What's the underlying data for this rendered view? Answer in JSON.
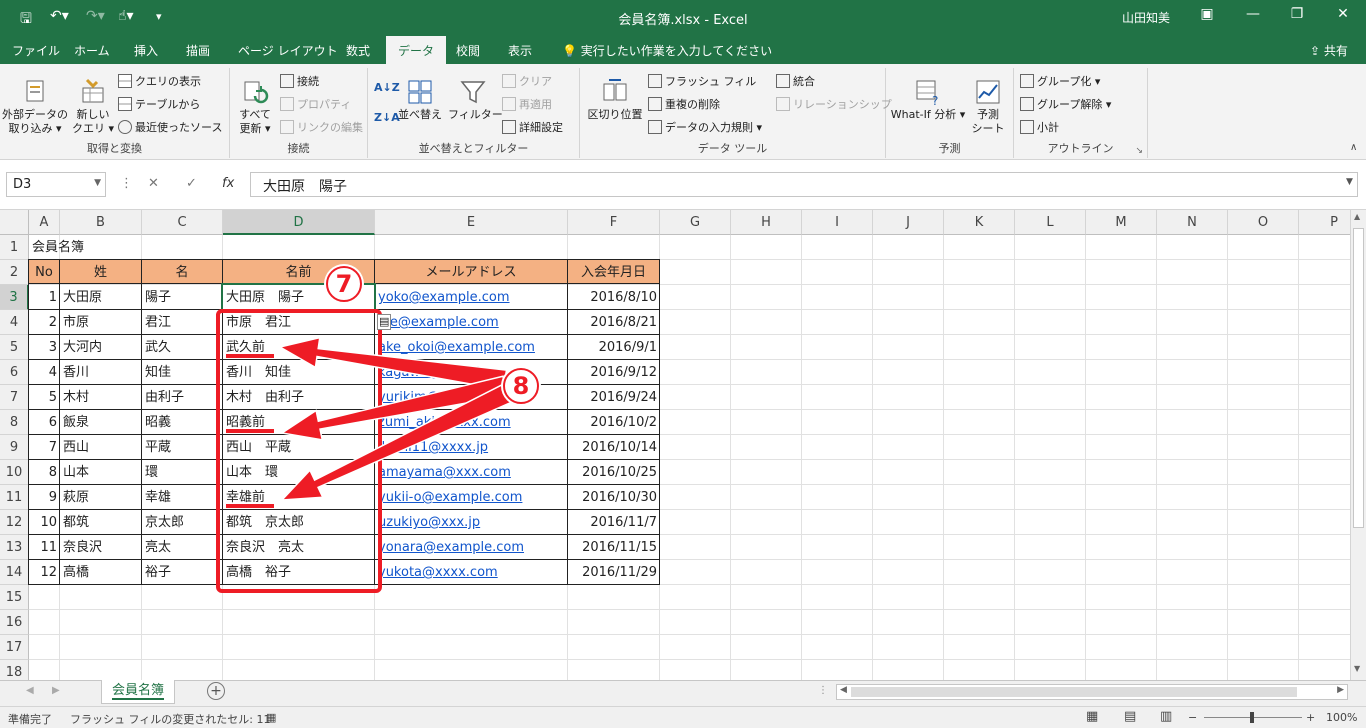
{
  "window": {
    "doc_title": "会員名簿.xlsx  -  Excel",
    "user": "山田知美"
  },
  "tabs": [
    "ファイル",
    "ホーム",
    "挿入",
    "描画",
    "ページ レイアウト",
    "数式",
    "データ",
    "校閲",
    "表示"
  ],
  "active_tab": "データ",
  "tell_me": "実行したい作業を入力してください",
  "share": "共有",
  "ribbon": {
    "get_transform": {
      "label": "取得と変換",
      "external_data": "外部データの",
      "external_data2": "取り込み",
      "new_query": "新しい",
      "new_query2": "クエリ",
      "show_queries": "クエリの表示",
      "from_table": "テーブルから",
      "recent_sources": "最近使ったソース"
    },
    "connections": {
      "label": "接続",
      "refresh_all": "すべて",
      "refresh_all2": "更新",
      "connections": "接続",
      "properties": "プロパティ",
      "edit_links": "リンクの編集"
    },
    "sort_filter": {
      "label": "並べ替えとフィルター",
      "sort": "並べ替え",
      "filter": "フィルター",
      "clear": "クリア",
      "reapply": "再適用",
      "advanced": "詳細設定"
    },
    "data_tools": {
      "label": "データ ツール",
      "text_to_columns": "区切り位置",
      "flash_fill": "フラッシュ フィル",
      "remove_duplicates": "重複の削除",
      "validation": "データの入力規則",
      "consolidate": "統合",
      "relationships": "リレーションシップ"
    },
    "forecast": {
      "label": "予測",
      "what_if": "What-If 分析",
      "forecast_sheet": "予測",
      "forecast_sheet2": "シート"
    },
    "outline": {
      "label": "アウトライン",
      "group": "グループ化",
      "ungroup": "グループ解除",
      "subtotal": "小計"
    }
  },
  "formula_bar": {
    "name_box": "D3",
    "content": "大田原　陽子"
  },
  "columns": [
    "A",
    "B",
    "C",
    "D",
    "E",
    "F",
    "G",
    "H",
    "I",
    "J",
    "K",
    "L",
    "M",
    "N",
    "O",
    "P"
  ],
  "rows": [
    "1",
    "2",
    "3",
    "4",
    "5",
    "6",
    "7",
    "8",
    "9",
    "10",
    "11",
    "12",
    "13",
    "14",
    "15",
    "16",
    "17",
    "18"
  ],
  "sheet": {
    "title": "会員名簿",
    "headers": [
      "No",
      "姓",
      "名",
      "名前",
      "メールアドレス",
      "入会年月日"
    ],
    "records": [
      {
        "no": "1",
        "sei": "大田原",
        "mei": "陽子",
        "name": "大田原　陽子",
        "email": "yoko@example.com",
        "date": "2016/8/10"
      },
      {
        "no": "2",
        "sei": "市原",
        "mei": "君江",
        "name": "市原　君江",
        "email": "hie@example.com",
        "date": "2016/8/21"
      },
      {
        "no": "3",
        "sei": "大河内",
        "mei": "武久",
        "name": "武久前",
        "email": "ake_okoi@example.com",
        "date": "2016/9/1"
      },
      {
        "no": "4",
        "sei": "香川",
        "mei": "知佳",
        "name": "香川　知佳",
        "email": "kagawa@xxxx.jp",
        "date": "2016/9/12"
      },
      {
        "no": "5",
        "sei": "木村",
        "mei": "由利子",
        "name": "木村　由利子",
        "email": "yurikim@example.com",
        "date": "2016/9/24"
      },
      {
        "no": "6",
        "sei": "飯泉",
        "mei": "昭義",
        "name": "昭義前",
        "email": "zumi_aki@xxxx.com",
        "date": "2016/10/2"
      },
      {
        "no": "7",
        "sei": "西山",
        "mei": "平蔵",
        "name": "西山　平蔵",
        "email": "ikichi11@xxxx.jp",
        "date": "2016/10/14"
      },
      {
        "no": "8",
        "sei": "山本",
        "mei": "環",
        "name": "山本　環",
        "email": "amayama@xxx.com",
        "date": "2016/10/25"
      },
      {
        "no": "9",
        "sei": "萩原",
        "mei": "幸雄",
        "name": "幸雄前",
        "email": "yukii-o@example.com",
        "date": "2016/10/30"
      },
      {
        "no": "10",
        "sei": "都筑",
        "mei": "京太郎",
        "name": "都筑　京太郎",
        "email": "uzukiyo@xxx.jp",
        "date": "2016/11/7"
      },
      {
        "no": "11",
        "sei": "奈良沢",
        "mei": "亮太",
        "name": "奈良沢　亮太",
        "email": "yonara@example.com",
        "date": "2016/11/15"
      },
      {
        "no": "12",
        "sei": "高橋",
        "mei": "裕子",
        "name": "高橋　裕子",
        "email": "yukota@xxxx.com",
        "date": "2016/11/29"
      }
    ]
  },
  "annotations": {
    "step7": "7",
    "step8": "8",
    "color": "#ee1c25"
  },
  "sheet_tab": "会員名簿",
  "status": {
    "ready": "準備完了",
    "flash_fill_msg": "フラッシュ フィルの変更されたセル: 11",
    "zoom": "100%"
  },
  "colors": {
    "accent": "#217346",
    "header_fill": "#f4b183",
    "link": "#1155cc"
  }
}
